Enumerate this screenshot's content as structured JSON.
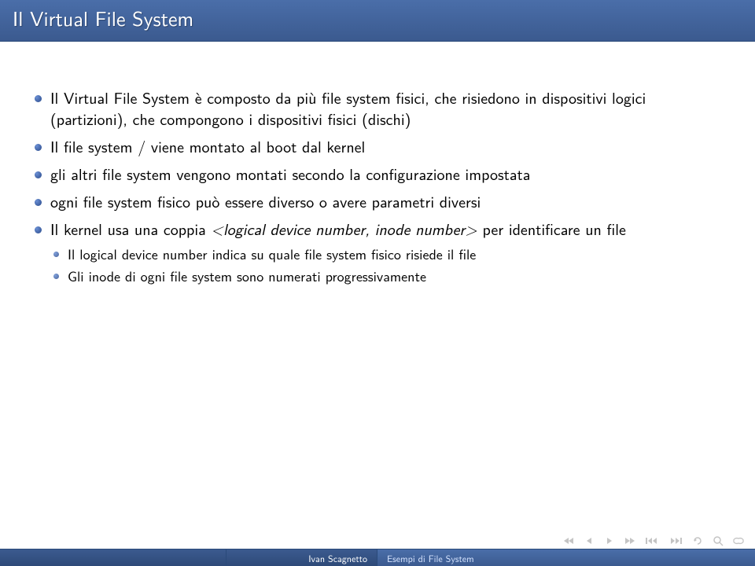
{
  "title": "Il Virtual File System",
  "bullets": [
    {
      "text": "Il Virtual File System è composto da più file system fisici, che risiedono in dispositivi logici (partizioni), che compongono i dispositivi fisici (dischi)"
    },
    {
      "text": "Il file system / viene montato al boot dal kernel"
    },
    {
      "text": "gli altri file system vengono montati secondo la configurazione impostata"
    },
    {
      "text": "ogni file system fisico può essere diverso o avere parametri diversi"
    },
    {
      "prefix": "Il kernel usa una coppia ",
      "emph": "<logical device number, inode number>",
      "suffix": " per identificare un file",
      "children": [
        "Il logical device number indica su quale file system fisico risiede il file",
        "Gli inode di ogni file system sono numerati progressivamente"
      ]
    }
  ],
  "footer": {
    "author": "Ivan Scagnetto",
    "talk": "Esempi di File System"
  }
}
